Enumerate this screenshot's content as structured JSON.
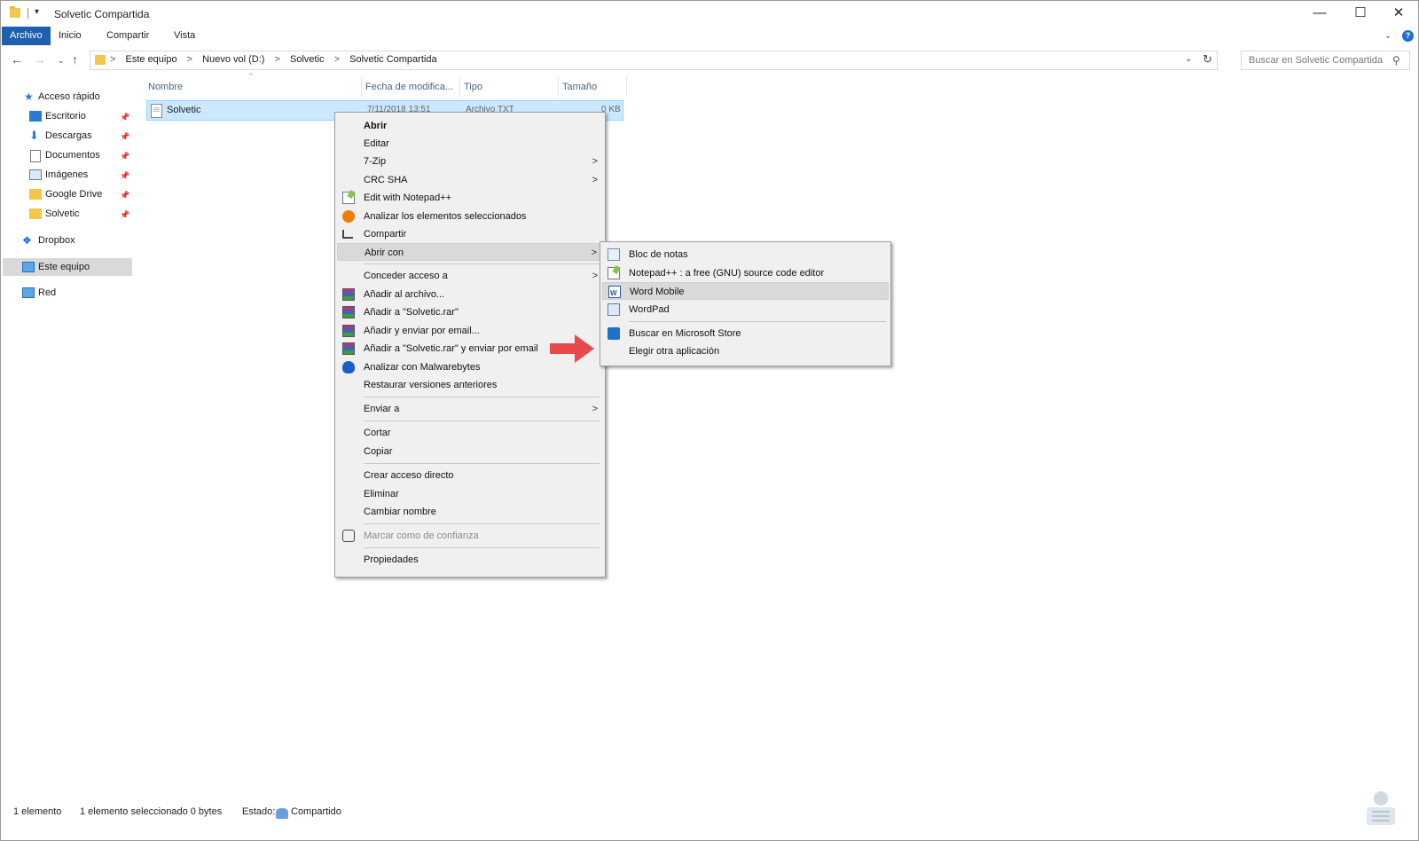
{
  "window": {
    "title": "Solvetic Compartida",
    "qa_dropdown": "▾",
    "btn_minimize": "—",
    "btn_maximize": "☐",
    "btn_close": "✕"
  },
  "ribbon": {
    "tabs": [
      "Archivo",
      "Inicio",
      "Compartir",
      "Vista"
    ],
    "collapse": "⌄",
    "help": "?"
  },
  "address": {
    "back": "←",
    "forward": "→",
    "recent": "⌄",
    "up": "↑",
    "crumbs": [
      "Este equipo",
      "Nuevo vol (D:)",
      "Solvetic",
      "Solvetic Compartida"
    ],
    "separator": ">",
    "dropdown": "⌄",
    "refresh": "↻",
    "search_placeholder": "Buscar en Solvetic Compartida",
    "search_icon": "⚲"
  },
  "nav": {
    "pin": "📌",
    "items": [
      {
        "label": "Acceso rápido",
        "icon": "star-icon"
      },
      {
        "label": "Escritorio",
        "icon": "desktop-icon",
        "pinned": true
      },
      {
        "label": "Descargas",
        "icon": "download-icon",
        "pinned": true
      },
      {
        "label": "Documentos",
        "icon": "document-icon",
        "pinned": true
      },
      {
        "label": "Imágenes",
        "icon": "pictures-icon",
        "pinned": true
      },
      {
        "label": "Google Drive",
        "icon": "folder-icon",
        "pinned": true
      },
      {
        "label": "Solvetic",
        "icon": "folder-icon",
        "pinned": true
      },
      {
        "label": "Dropbox",
        "icon": "dropbox-icon"
      },
      {
        "label": "Este equipo",
        "icon": "computer-icon",
        "selected": true
      },
      {
        "label": "Red",
        "icon": "network-icon"
      }
    ]
  },
  "columns": {
    "name": "Nombre",
    "date": "Fecha de modifica...",
    "type": "Tipo",
    "size": "Tamaño",
    "sort": "^"
  },
  "file": {
    "name": "Solvetic",
    "date": "7/11/2018 13:51",
    "type": "Archivo TXT",
    "size": "0 KB"
  },
  "context_menu": {
    "submenu_arrow": ">",
    "items": [
      {
        "label": "Abrir",
        "bold": true
      },
      {
        "label": "Editar"
      },
      {
        "label": "7-Zip",
        "submenu": true
      },
      {
        "label": "CRC SHA",
        "submenu": true
      },
      {
        "label": "Edit with Notepad++",
        "icon": "notepadpp-icon"
      },
      {
        "label": "Analizar los elementos seleccionados",
        "icon": "avast-icon"
      },
      {
        "label": "Compartir",
        "icon": "share-icon"
      },
      {
        "label": "Abrir con",
        "submenu": true,
        "highlighted": true
      },
      {
        "label": "Conceder acceso a",
        "submenu": true
      },
      {
        "label": "Añadir al archivo...",
        "icon": "winrar-icon"
      },
      {
        "label": "Añadir a \"Solvetic.rar\"",
        "icon": "winrar-icon"
      },
      {
        "label": "Añadir y enviar por email...",
        "icon": "winrar-icon"
      },
      {
        "label": "Añadir a \"Solvetic.rar\" y enviar por email",
        "icon": "winrar-icon"
      },
      {
        "label": "Analizar con Malwarebytes",
        "icon": "malwarebytes-icon"
      },
      {
        "label": "Restaurar versiones anteriores"
      },
      {
        "label": "Enviar a",
        "submenu": true
      },
      {
        "label": "Cortar"
      },
      {
        "label": "Copiar"
      },
      {
        "label": "Crear acceso directo"
      },
      {
        "label": "Eliminar"
      },
      {
        "label": "Cambiar nombre"
      },
      {
        "label": "Marcar como de confianza",
        "icon": "shield-icon",
        "disabled": true
      },
      {
        "label": "Propiedades"
      }
    ]
  },
  "open_with_menu": {
    "items": [
      {
        "label": "Bloc de notas",
        "icon": "notepad-icon"
      },
      {
        "label": "Notepad++ : a free (GNU) source code editor",
        "icon": "notepadpp-icon"
      },
      {
        "label": "Word Mobile",
        "icon": "word-icon",
        "highlighted": true
      },
      {
        "label": "WordPad",
        "icon": "wordpad-icon"
      },
      {
        "label": "Buscar en Microsoft Store",
        "icon": "store-icon"
      },
      {
        "label": "Elegir otra aplicación"
      }
    ]
  },
  "statusbar": {
    "count": "1 elemento",
    "selected": "1 elemento seleccionado  0 bytes",
    "state_label": "Estado:",
    "state_value": "Compartido"
  },
  "colors": {
    "file_tab": "#1f5fae",
    "selection": "#cce8ff",
    "menu_bg": "#f0f0f0",
    "menu_highlight": "#d9d9d9",
    "arrow": "#e84a4a"
  }
}
